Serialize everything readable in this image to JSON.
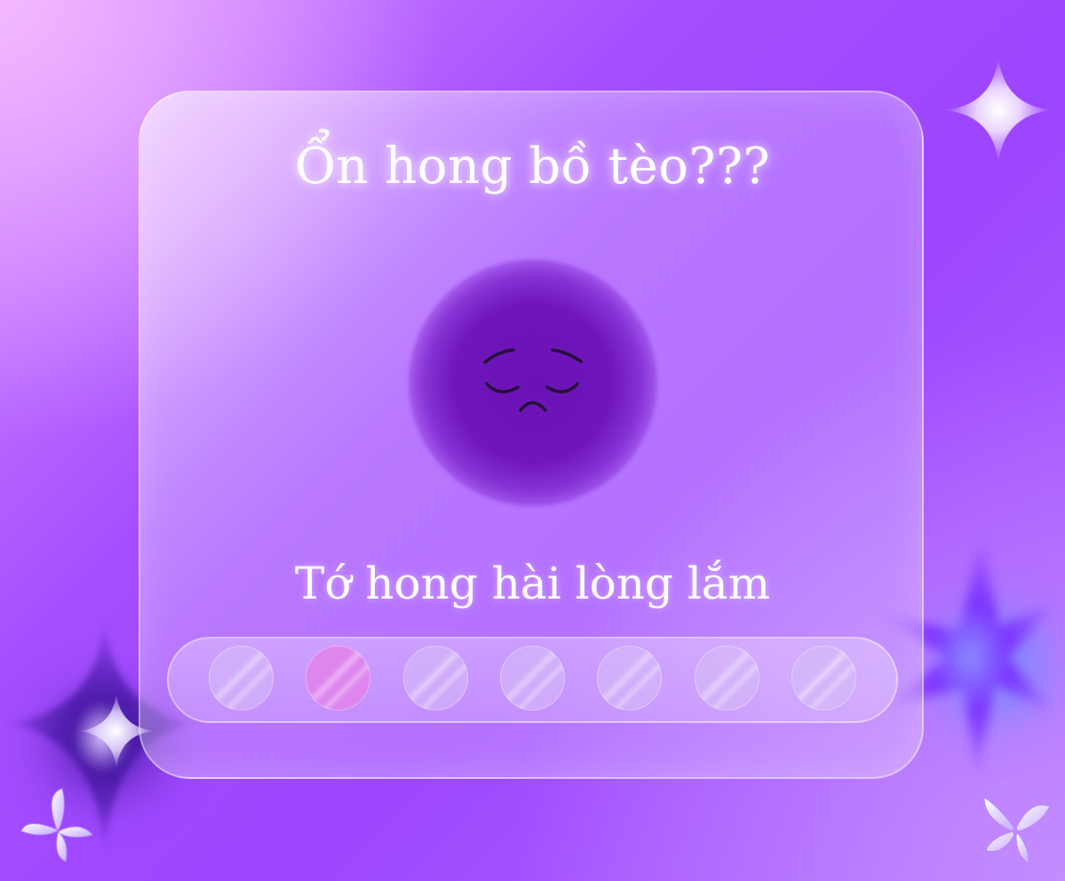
{
  "survey": {
    "question": "Ổn hong bồ tèo???",
    "caption": "Tớ hong hài lòng lắm",
    "rating": {
      "options": 7,
      "selected": 2
    },
    "face_icon": "sad-face-icon"
  },
  "decorations": {
    "icons": [
      "sparkle-icon",
      "butterfly-icon"
    ]
  },
  "colors": {
    "accent": "#9d45ff",
    "orb": "#6a12b6",
    "selected_dot": "#e282eb",
    "text": "#ffffff"
  }
}
